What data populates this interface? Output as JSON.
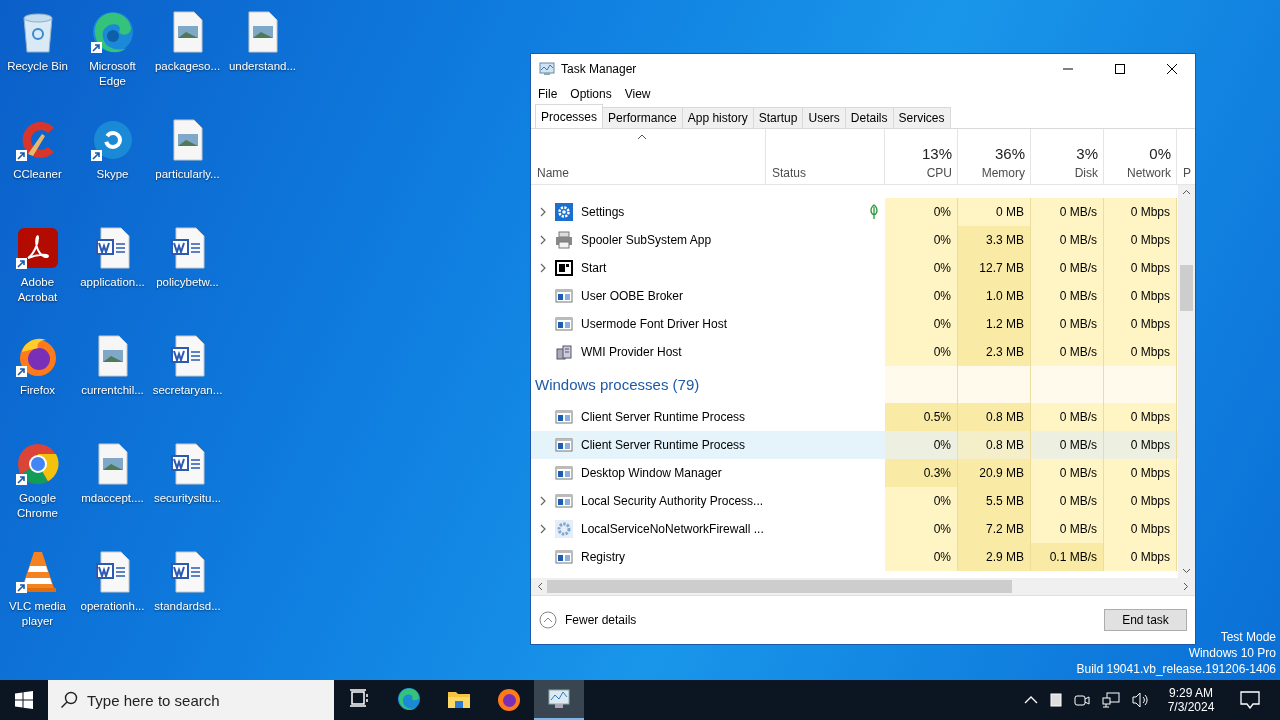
{
  "desktop_icons": [
    {
      "label": "Recycle Bin",
      "kind": "recycle",
      "shortcut": false
    },
    {
      "label": "Microsoft Edge",
      "kind": "edge",
      "shortcut": true
    },
    {
      "label": "packageso...",
      "kind": "image",
      "shortcut": false
    },
    {
      "label": "understand...",
      "kind": "image",
      "shortcut": false
    },
    {
      "label": "CCleaner",
      "kind": "ccleaner",
      "shortcut": true
    },
    {
      "label": "Skype",
      "kind": "skype",
      "shortcut": true
    },
    {
      "label": "particularly...",
      "kind": "image",
      "shortcut": false
    },
    {
      "label": "Adobe Acrobat",
      "kind": "acrobat",
      "shortcut": true
    },
    {
      "label": "application...",
      "kind": "word",
      "shortcut": false
    },
    {
      "label": "policybetw...",
      "kind": "word",
      "shortcut": false
    },
    {
      "label": "Firefox",
      "kind": "firefox",
      "shortcut": true
    },
    {
      "label": "currentchil...",
      "kind": "image",
      "shortcut": false
    },
    {
      "label": "secretaryan...",
      "kind": "word",
      "shortcut": false
    },
    {
      "label": "Google Chrome",
      "kind": "chrome",
      "shortcut": true
    },
    {
      "label": "mdaccept....",
      "kind": "image",
      "shortcut": false
    },
    {
      "label": "securitysitu...",
      "kind": "word",
      "shortcut": false
    },
    {
      "label": "VLC media player",
      "kind": "vlc",
      "shortcut": true
    },
    {
      "label": "operationh...",
      "kind": "word",
      "shortcut": false
    },
    {
      "label": "standardsd...",
      "kind": "word",
      "shortcut": false
    }
  ],
  "window": {
    "title": "Task Manager",
    "menu": [
      "File",
      "Options",
      "View"
    ],
    "tabs": [
      {
        "label": "Processes",
        "selected": true
      },
      {
        "label": "Performance",
        "selected": false
      },
      {
        "label": "App history",
        "selected": false
      },
      {
        "label": "Startup",
        "selected": false
      },
      {
        "label": "Users",
        "selected": false
      },
      {
        "label": "Details",
        "selected": false
      },
      {
        "label": "Services",
        "selected": false
      }
    ],
    "columns": [
      {
        "label": "Name"
      },
      {
        "label": "Status"
      },
      {
        "label": "CPU",
        "percent": "13%"
      },
      {
        "label": "Memory",
        "percent": "36%"
      },
      {
        "label": "Disk",
        "percent": "3%"
      },
      {
        "label": "Network",
        "percent": "0%"
      },
      {
        "label": "P"
      }
    ],
    "app_rows": [
      {
        "kind": "settings",
        "name": "Settings",
        "expandable": true,
        "suspended": true,
        "selected": false,
        "cells": [
          {
            "text": "0%",
            "hot": false
          },
          {
            "text": "0 MB",
            "hot": false
          },
          {
            "text": "0 MB/s",
            "hot": false
          },
          {
            "text": "0 Mbps",
            "hot": false
          }
        ]
      },
      {
        "kind": "printer",
        "name": "Spooler SubSystem App",
        "expandable": true,
        "suspended": false,
        "selected": false,
        "cells": [
          {
            "text": "0%",
            "hot": false
          },
          {
            "text": "3.3 MB",
            "hot": true
          },
          {
            "text": "0 MB/s",
            "hot": false
          },
          {
            "text": "0 Mbps",
            "hot": false
          }
        ]
      },
      {
        "kind": "start",
        "name": "Start",
        "expandable": true,
        "suspended": false,
        "selected": false,
        "cells": [
          {
            "text": "0%",
            "hot": false
          },
          {
            "text": "12.7 MB",
            "hot": true
          },
          {
            "text": "0 MB/s",
            "hot": false
          },
          {
            "text": "0 Mbps",
            "hot": false
          }
        ]
      },
      {
        "kind": "window",
        "name": "User OOBE Broker",
        "expandable": false,
        "suspended": false,
        "selected": false,
        "cells": [
          {
            "text": "0%",
            "hot": false
          },
          {
            "text": "1.0 MB",
            "hot": true
          },
          {
            "text": "0 MB/s",
            "hot": false
          },
          {
            "text": "0 Mbps",
            "hot": false
          }
        ]
      },
      {
        "kind": "window",
        "name": "Usermode Font Driver Host",
        "expandable": false,
        "suspended": false,
        "selected": false,
        "cells": [
          {
            "text": "0%",
            "hot": false
          },
          {
            "text": "1.2 MB",
            "hot": true
          },
          {
            "text": "0 MB/s",
            "hot": false
          },
          {
            "text": "0 Mbps",
            "hot": false
          }
        ]
      },
      {
        "kind": "wmi",
        "name": "WMI Provider Host",
        "expandable": false,
        "suspended": false,
        "selected": false,
        "cells": [
          {
            "text": "0%",
            "hot": false
          },
          {
            "text": "2.3 MB",
            "hot": true
          },
          {
            "text": "0 MB/s",
            "hot": false
          },
          {
            "text": "0 Mbps",
            "hot": false
          }
        ]
      }
    ],
    "windows_processes": {
      "heading": "Windows processes (79)",
      "rows": [
        {
          "kind": "window",
          "name": "Client Server Runtime Process",
          "expandable": false,
          "suspended": false,
          "selected": false,
          "cells": [
            {
              "text": "0.5%",
              "hot": true
            },
            {
              "text": "0.8 MB",
              "hot": true
            },
            {
              "text": "0 MB/s",
              "hot": false
            },
            {
              "text": "0 Mbps",
              "hot": false
            }
          ]
        },
        {
          "kind": "window",
          "name": "Client Server Runtime Process",
          "expandable": false,
          "suspended": false,
          "selected": true,
          "cells": [
            {
              "text": "0%",
              "hot": false
            },
            {
              "text": "0.8 MB",
              "hot": true
            },
            {
              "text": "0 MB/s",
              "hot": false
            },
            {
              "text": "0 Mbps",
              "hot": false
            }
          ]
        },
        {
          "kind": "window",
          "name": "Desktop Window Manager",
          "expandable": false,
          "suspended": false,
          "selected": false,
          "cells": [
            {
              "text": "0.3%",
              "hot": true
            },
            {
              "text": "20.9 MB",
              "hot": true
            },
            {
              "text": "0 MB/s",
              "hot": false
            },
            {
              "text": "0 Mbps",
              "hot": false
            }
          ]
        },
        {
          "kind": "window",
          "name": "Local Security Authority Process...",
          "expandable": true,
          "suspended": false,
          "selected": false,
          "cells": [
            {
              "text": "0%",
              "hot": false
            },
            {
              "text": "5.5 MB",
              "hot": true
            },
            {
              "text": "0 MB/s",
              "hot": false
            },
            {
              "text": "0 Mbps",
              "hot": false
            }
          ]
        },
        {
          "kind": "gear",
          "name": "LocalServiceNoNetworkFirewall ...",
          "expandable": true,
          "suspended": false,
          "selected": false,
          "cells": [
            {
              "text": "0%",
              "hot": false
            },
            {
              "text": "7.2 MB",
              "hot": true
            },
            {
              "text": "0 MB/s",
              "hot": false
            },
            {
              "text": "0 Mbps",
              "hot": false
            }
          ]
        },
        {
          "kind": "window",
          "name": "Registry",
          "expandable": false,
          "suspended": false,
          "selected": false,
          "cells": [
            {
              "text": "0%",
              "hot": false
            },
            {
              "text": "2.9 MB",
              "hot": true
            },
            {
              "text": "0.1 MB/s",
              "hot": true
            },
            {
              "text": "0 Mbps",
              "hot": false
            }
          ]
        }
      ]
    },
    "fewer_details": "Fewer details",
    "end_task": "End task"
  },
  "test_mode": [
    "Test Mode",
    "Windows 10 Pro",
    "Build 19041.vb_release.191206-1406"
  ],
  "taskbar": {
    "search_placeholder": "Type here to search",
    "apps": [
      {
        "kind": "taskview",
        "active": false
      },
      {
        "kind": "edge",
        "active": false
      },
      {
        "kind": "explorer",
        "active": false
      },
      {
        "kind": "firefox",
        "active": false
      },
      {
        "kind": "taskmgr",
        "active": true
      }
    ],
    "time": "9:29 AM",
    "date": "7/3/2024"
  }
}
